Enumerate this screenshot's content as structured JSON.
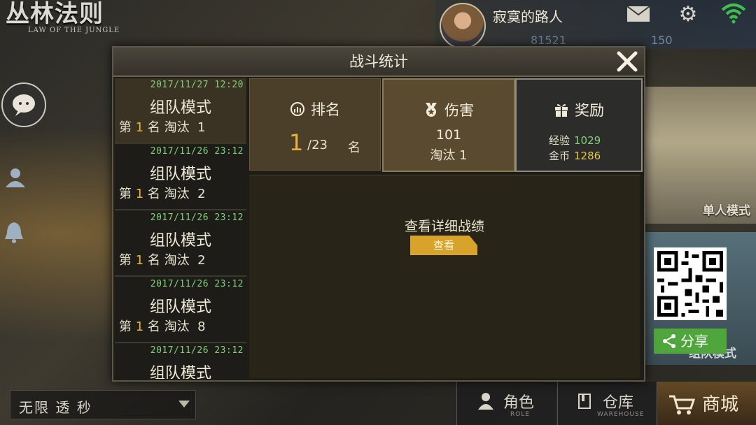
{
  "logo": {
    "cn": "丛林法则",
    "en": "LAW OF THE JUNGLE"
  },
  "user": {
    "name": "寂寞的路人",
    "currency_a": "81521",
    "currency_b": "150"
  },
  "dialog": {
    "title": "战斗统计",
    "history": [
      {
        "date": "2017/11/27 12:20",
        "mode": "组队模式",
        "rank": "1",
        "kills": "1"
      },
      {
        "date": "2017/11/26 23:12",
        "mode": "组队模式",
        "rank": "1",
        "kills": "2"
      },
      {
        "date": "2017/11/26 23:12",
        "mode": "组队模式",
        "rank": "1",
        "kills": "2"
      },
      {
        "date": "2017/11/26 23:12",
        "mode": "组队模式",
        "rank": "1",
        "kills": "8"
      },
      {
        "date": "2017/11/26 23:12",
        "mode": "组队模式"
      }
    ],
    "labels": {
      "rank_prefix": "第",
      "rank_suffix": "名",
      "kills_label": "淘汰"
    },
    "rank_box": {
      "title": "排名",
      "value": "1",
      "total": "/23",
      "unit": "名"
    },
    "damage_box": {
      "title": "伤害",
      "value": "101",
      "kills_label": "淘汰",
      "kills": "1"
    },
    "reward_box": {
      "title": "奖励",
      "exp_label": "经验",
      "exp": "1029",
      "gold_label": "金币",
      "gold": "1286"
    },
    "detail": {
      "text": "查看详细战绩",
      "button": "查看"
    }
  },
  "side": {
    "solo_label": "单人模式",
    "team_label": "组队模式",
    "share_label": "分享"
  },
  "bottom": {
    "mode_select": "无限 透 秒",
    "nav": [
      {
        "label": "角色",
        "sub": "ROLE"
      },
      {
        "label": "仓库",
        "sub": "WAREHOUSE"
      },
      {
        "label": "商城"
      }
    ]
  },
  "colors": {
    "accent_gold": "#e8b23a",
    "date_green": "#7fd17a",
    "share_green": "#4ea63c"
  },
  "icons": [
    "mail-icon",
    "gear-icon",
    "wifi-icon",
    "chat-icon",
    "friends-icon",
    "bell-icon",
    "close-icon",
    "rank-icon",
    "medal-icon",
    "gift-icon",
    "share-icon",
    "role-icon",
    "warehouse-icon",
    "cart-icon",
    "dropdown-arrow-icon"
  ]
}
